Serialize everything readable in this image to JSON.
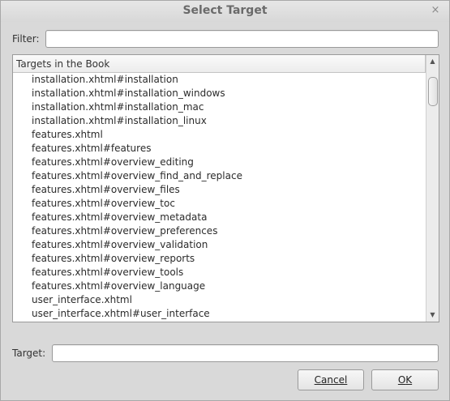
{
  "window": {
    "title": "Select Target",
    "close_glyph": "×"
  },
  "filter": {
    "label": "Filter:",
    "value": ""
  },
  "list": {
    "header": "Targets in the Book",
    "items": [
      "installation.xhtml#installation",
      "installation.xhtml#installation_windows",
      "installation.xhtml#installation_mac",
      "installation.xhtml#installation_linux",
      "features.xhtml",
      "features.xhtml#features",
      "features.xhtml#overview_editing",
      "features.xhtml#overview_find_and_replace",
      "features.xhtml#overview_files",
      "features.xhtml#overview_toc",
      "features.xhtml#overview_metadata",
      "features.xhtml#overview_preferences",
      "features.xhtml#overview_validation",
      "features.xhtml#overview_reports",
      "features.xhtml#overview_tools",
      "features.xhtml#overview_language",
      "user_interface.xhtml",
      "user_interface.xhtml#user_interface"
    ],
    "scroll_up_glyph": "▲",
    "scroll_down_glyph": "▼"
  },
  "target": {
    "label": "Target:",
    "value": ""
  },
  "buttons": {
    "cancel_mnemonic": "C",
    "cancel_rest": "ancel",
    "ok_mnemonic": "O",
    "ok_rest": "K"
  }
}
